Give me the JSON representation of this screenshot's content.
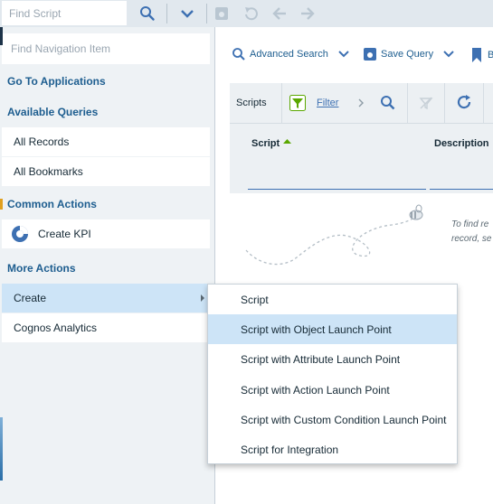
{
  "toolbar": {
    "search_placeholder": "Find Script",
    "search_icon": "search-icon",
    "dropdown_icon": "chevron-down-icon"
  },
  "nav": {
    "search_placeholder": "Find Navigation Item",
    "go_to_applications": "Go To Applications",
    "available_queries": "Available Queries",
    "queries": [
      "All Records",
      "All Bookmarks"
    ],
    "common_actions": "Common Actions",
    "create_kpi": "Create KPI",
    "more_actions": "More Actions",
    "create": "Create",
    "cognos": "Cognos Analytics"
  },
  "main": {
    "advanced_search": "Advanced Search",
    "save_query": "Save Query",
    "bookmark_partial": "B",
    "table_title": "Scripts",
    "filter": "Filter",
    "col_script": "Script",
    "col_description": "Description",
    "empty_hint_line1": "To find re",
    "empty_hint_line2": "record, se"
  },
  "menu": {
    "items": [
      "Script",
      "Script with Object Launch Point",
      "Script with Attribute Launch Point",
      "Script with Action Launch Point",
      "Script with Custom Condition Launch Point",
      "Script for Integration"
    ],
    "highlighted_index": 1
  },
  "colors": {
    "accent": "#1d5d8f",
    "link": "#3d70b2",
    "hover": "#cde4f7",
    "toolbar": "#e1e8ee"
  }
}
